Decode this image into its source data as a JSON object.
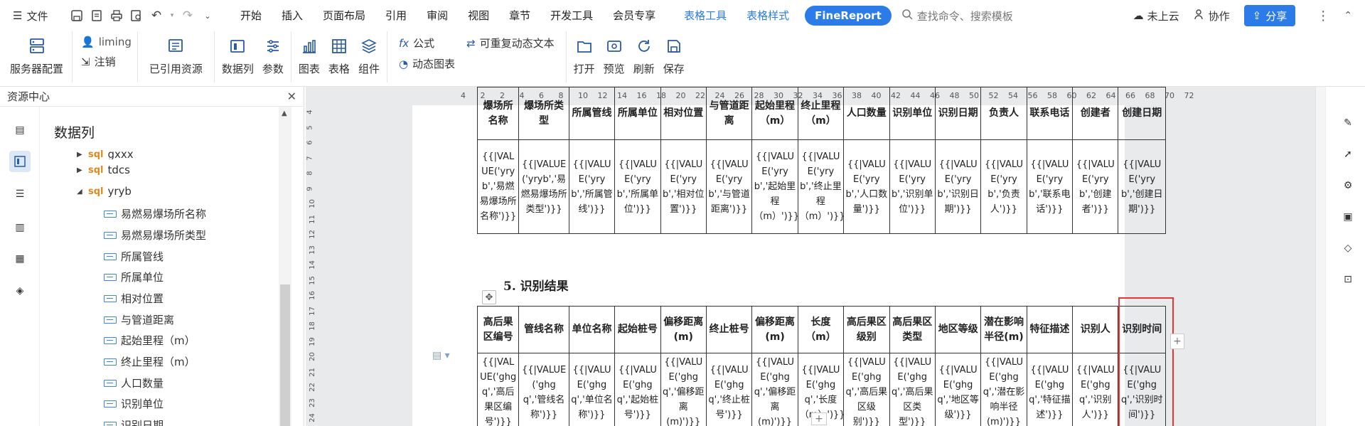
{
  "menubar": {
    "file_label": "文件",
    "tabs": [
      "开始",
      "插入",
      "页面布局",
      "引用",
      "审阅",
      "视图",
      "章节",
      "开发工具",
      "会员专享"
    ],
    "context_tabs": [
      "表格工具",
      "表格样式"
    ],
    "pill_tab": "FineReport",
    "search_placeholder": "查找命令、搜索模板",
    "cloud": "未上云",
    "collab": "协作",
    "share": "分享"
  },
  "ribbon": {
    "server_config": "服务器配置",
    "user": "liming",
    "logout": "注销",
    "referenced": "已引用资源",
    "data_column": "数据列",
    "params": "参数",
    "chart": "图表",
    "table": "表格",
    "component": "组件",
    "formula": "公式",
    "dynamic_chart": "动态图表",
    "repeat_text": "可重复动态文本",
    "open": "打开",
    "preview": "预览",
    "refresh": "刷新",
    "save": "保存"
  },
  "left_panel": {
    "title": "资源中心",
    "section": "数据列",
    "tree": [
      {
        "label": "gxxx",
        "type": "sql",
        "expanded": false
      },
      {
        "label": "tdcs",
        "type": "sql",
        "expanded": false
      },
      {
        "label": "yryb",
        "type": "sql",
        "expanded": true
      }
    ],
    "columns": [
      "易燃易爆场所名称",
      "易燃易爆场所类型",
      "所属管线",
      "所属单位",
      "相对位置",
      "与管道距离",
      "起始里程（m）",
      "终止里程（m）",
      "人口数量",
      "识别单位",
      "识别日期"
    ]
  },
  "ruler": {
    "h": [
      "4",
      "2",
      "2",
      "4",
      "6",
      "8",
      "10",
      "12",
      "14",
      "16",
      "18",
      "20",
      "22",
      "24",
      "26",
      "28",
      "30",
      "32",
      "34",
      "36",
      "38",
      "40",
      "42",
      "44",
      "46",
      "48",
      "50",
      "52",
      "54",
      "56",
      "58",
      "60",
      "62",
      "64",
      "66",
      "68",
      "70",
      "72"
    ],
    "v": [
      "4",
      "5",
      "6",
      "7",
      "8",
      "9",
      "10",
      "11",
      "12",
      "13",
      "14",
      "15",
      "16",
      "17",
      "18",
      "19",
      "20",
      "21",
      "22",
      "23",
      "24"
    ]
  },
  "table1": {
    "headers": [
      "爆场所名称",
      "爆场所类型",
      "所属管线",
      "所属单位",
      "相对位置",
      "与管道距离",
      "起始里程（m）",
      "终止里程（m）",
      "人口数量",
      "识别单位",
      "识别日期",
      "负责人",
      "联系电话",
      "创建者",
      "创建日期"
    ],
    "cells": [
      "{{|VALUE('yryb','易燃易爆场所名称')}}",
      "{{|VALUE('yryb','易燃易爆场所类型')}}",
      "{{|VALUE('yryb','所属管线')}}",
      "{{|VALUE('yryb','所属单位')}}",
      "{{|VALUE('yryb','相对位置')}}",
      "{{|VALUE('yryb','与管道距离')}}",
      "{{|VALUE('yryb','起始里程（m）')}}",
      "{{|VALUE('yryb','终止里程（m）')}}",
      "{{|VALUE('yryb','人口数量')}}",
      "{{|VALUE('yryb','识别单位')}}",
      "{{|VALUE('yryb','识别日期')}}",
      "{{|VALUE('yryb','负责人')}}",
      "{{|VALUE('yryb','联系电话')}}",
      "{{|VALUE('yryb','创建者')}}",
      "{{|VALUE('yryb','创建日期')}}"
    ]
  },
  "section": "5.   识别结果",
  "table2": {
    "headers": [
      "高后果区编号",
      "管线名称",
      "单位名称",
      "起始桩号",
      "偏移距离(m)",
      "终止桩号",
      "偏移距离(m)",
      "长度（m）",
      "高后果区级别",
      "高后果区类型",
      "地区等级",
      "潜在影响半径(m)",
      "特征描述",
      "识别人",
      "识别时间"
    ],
    "cells": [
      "{{|VALUE('ghgq','高后果区编号')}}",
      "{{|VALUE('ghgq','管线名称')}}",
      "{{|VALUE('ghgq','单位名称')}}",
      "{{|VALUE('ghgq','起始桩号')}}",
      "{{|VALUE('ghgq','偏移距离(m)')}}",
      "{{|VALUE('ghgq','终止桩号')}}",
      "{{|VALUE('ghgq','偏移距离(m)')}}",
      "{{|VALUE('ghgq','长度（m）')}}",
      "{{|VALUE('ghgq','高后果区级别')}}",
      "{{|VALUE('ghgq','高后果区类型')}}",
      "{{|VALUE('ghgq','地区等级')}}",
      "{{|VALUE('ghgq','潜在影响半径(m)')}}",
      "{{|VALUE('ghgq','特征描述')}}",
      "{{|VALUE('ghgq','识别人')}}",
      "{{|VALUE('ghgq','识别时间')}}"
    ]
  },
  "colors": {
    "accent": "#2b7be8",
    "highlight": "#e33333",
    "sql": "#e08a1e"
  }
}
